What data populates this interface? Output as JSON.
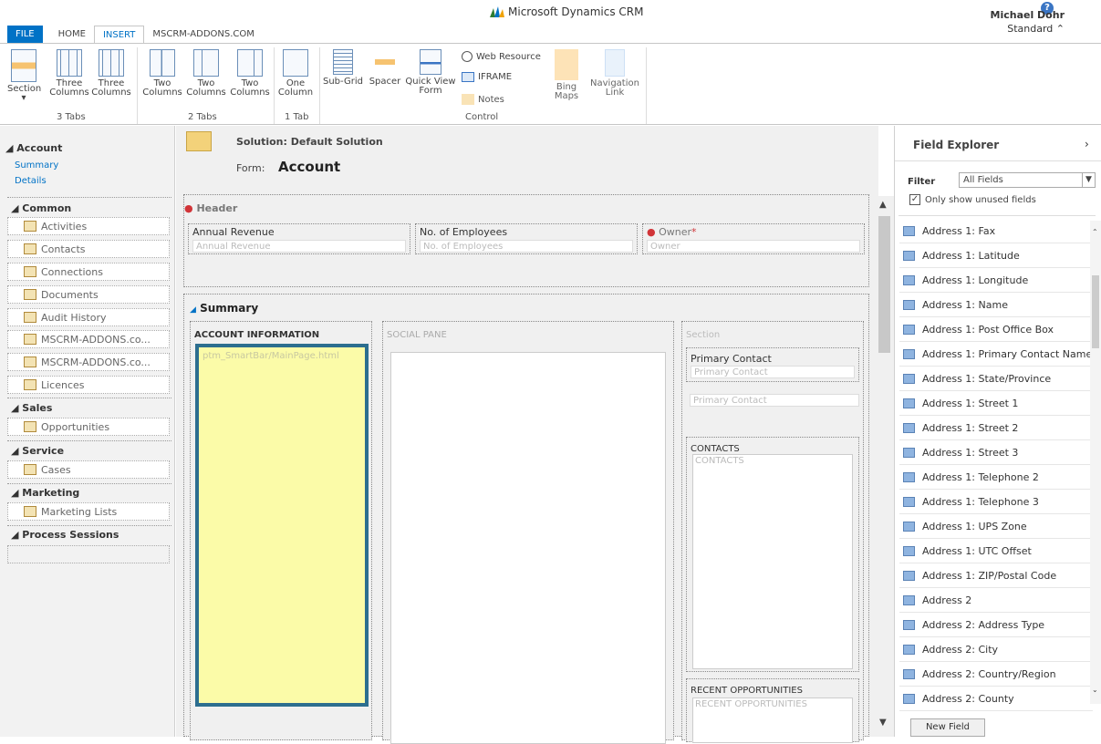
{
  "app": {
    "title": "Microsoft Dynamics CRM"
  },
  "user": {
    "name": "Michael Dohr",
    "role": "Standard"
  },
  "tabs": [
    "FILE",
    "HOME",
    "INSERT",
    "MSCRM-ADDONS.COM"
  ],
  "ribbon": {
    "buttons": {
      "section": "Section",
      "three_columns_1": "Three Columns",
      "three_columns_2": "Three Columns",
      "two_columns_1": "Two Columns",
      "two_columns_2": "Two Columns",
      "two_columns_3": "Two Columns",
      "one_column": "One Column",
      "sub_grid": "Sub-Grid",
      "spacer": "Spacer",
      "quick_view_form": "Quick View Form",
      "web_resource": "Web Resource",
      "iframe": "IFRAME",
      "notes": "Notes",
      "bing_maps": "Bing Maps",
      "navigation_link": "Navigation Link"
    },
    "groups": {
      "g1": "3 Tabs",
      "g2": "2 Tabs",
      "g3": "1 Tab",
      "g4": "Control"
    }
  },
  "nav": {
    "account": "Account",
    "summary": "Summary",
    "details": "Details",
    "common": "Common",
    "common_items": [
      "Activities",
      "Contacts",
      "Connections",
      "Documents",
      "Audit History",
      "MSCRM-ADDONS.co...",
      "MSCRM-ADDONS.co...",
      "Licences"
    ],
    "sales": "Sales",
    "sales_items": [
      "Opportunities"
    ],
    "service": "Service",
    "service_items": [
      "Cases"
    ],
    "marketing": "Marketing",
    "marketing_items": [
      "Marketing Lists"
    ],
    "process_sessions": "Process Sessions"
  },
  "form": {
    "solution": "Solution: Default Solution",
    "form_label": "Form:",
    "form_name": "Account",
    "header": "Header",
    "annual_revenue": "Annual Revenue",
    "annual_revenue_ph": "Annual Revenue",
    "employees": "No. of Employees",
    "employees_ph": "No. of Employees",
    "owner": "Owner",
    "owner_ph": "Owner",
    "summary": "Summary",
    "account_information": "ACCOUNT INFORMATION",
    "webresource_ph": "ptm_SmartBar/MainPage.html",
    "social_pane": "SOCIAL PANE",
    "section": "Section",
    "primary_contact": "Primary Contact",
    "primary_contact_ph": "Primary Contact",
    "primary_contact_ph2": "Primary Contact",
    "contacts": "CONTACTS",
    "contacts_ph": "CONTACTS",
    "recent_opps": "RECENT OPPORTUNITIES",
    "recent_opps_ph": "RECENT OPPORTUNITIES"
  },
  "field_explorer": {
    "title": "Field Explorer",
    "filter_label": "Filter",
    "filter_value": "All Fields",
    "unused_label": "Only show unused fields",
    "unused_checked": true,
    "fields": [
      "Address 1: Fax",
      "Address 1: Latitude",
      "Address 1: Longitude",
      "Address 1: Name",
      "Address 1: Post Office Box",
      "Address 1: Primary Contact Name",
      "Address 1: State/Province",
      "Address 1: Street 1",
      "Address 1: Street 2",
      "Address 1: Street 3",
      "Address 1: Telephone 2",
      "Address 1: Telephone 3",
      "Address 1: UPS Zone",
      "Address 1: UTC Offset",
      "Address 1: ZIP/Postal Code",
      "Address 2",
      "Address 2: Address Type",
      "Address 2: City",
      "Address 2: Country/Region",
      "Address 2: County"
    ],
    "new_field": "New Field"
  }
}
